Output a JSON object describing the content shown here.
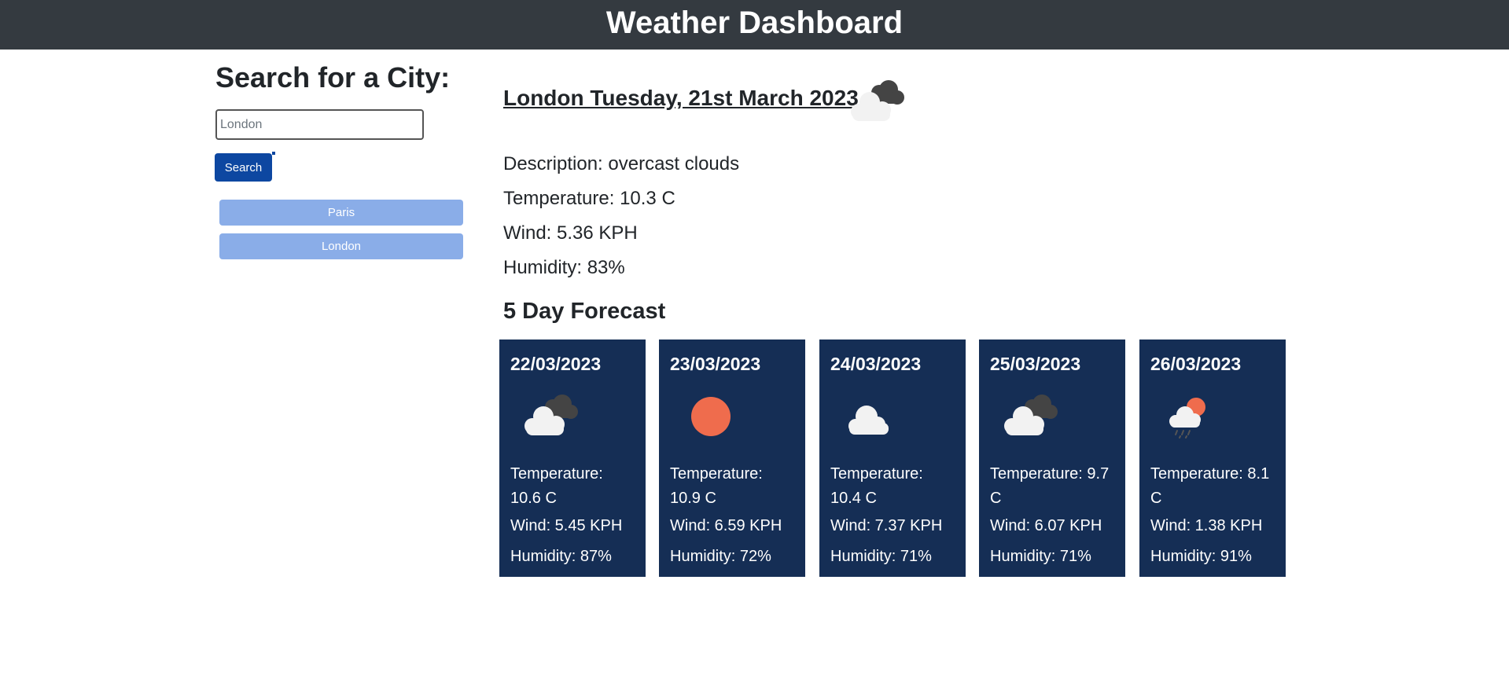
{
  "header": {
    "title": "Weather Dashboard"
  },
  "search": {
    "heading": "Search for a City:",
    "placeholder": "London",
    "button_label": "Search",
    "history": [
      "Paris",
      "London"
    ]
  },
  "current": {
    "title": "London Tuesday, 21st March 2023",
    "icon": "broken-clouds-icon",
    "description": "Description: overcast clouds",
    "temperature": "Temperature: 10.3 C",
    "wind": "Wind: 5.36 KPH",
    "humidity": "Humidity: 83%"
  },
  "forecast": {
    "heading": "5 Day Forecast",
    "days": [
      {
        "date": "22/03/2023",
        "icon": "broken-clouds-icon",
        "temperature": "Temperature: 10.6 C",
        "wind": "Wind: 5.45 KPH",
        "humidity": "Humidity: 87%"
      },
      {
        "date": "23/03/2023",
        "icon": "clear-sky-icon",
        "temperature": "Temperature: 10.9 C",
        "wind": "Wind: 6.59 KPH",
        "humidity": "Humidity: 72%"
      },
      {
        "date": "24/03/2023",
        "icon": "cloud-icon",
        "temperature": "Temperature: 10.4 C",
        "wind": "Wind: 7.37 KPH",
        "humidity": "Humidity: 71%"
      },
      {
        "date": "25/03/2023",
        "icon": "broken-clouds-icon",
        "temperature": "Temperature: 9.7 C",
        "wind": "Wind: 6.07 KPH",
        "humidity": "Humidity: 71%"
      },
      {
        "date": "26/03/2023",
        "icon": "rain-sun-icon",
        "temperature": "Temperature: 8.1 C",
        "wind": "Wind: 1.38 KPH",
        "humidity": "Humidity: 91%"
      }
    ]
  },
  "colors": {
    "header_bg": "#343a40",
    "search_button": "#0d47a1",
    "history_button": "#8aade8",
    "card_bg": "#152e55",
    "sun": "#ef6c4d"
  }
}
